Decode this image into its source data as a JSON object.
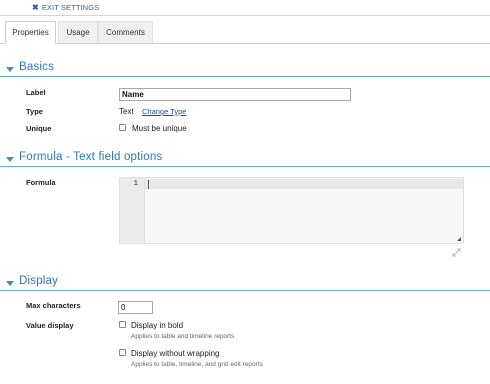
{
  "topbar": {
    "exit_label": "EXIT SETTINGS",
    "exit_icon": "close-icon"
  },
  "tabs": [
    {
      "label": "Properties",
      "active": true
    },
    {
      "label": "Usage",
      "active": false
    },
    {
      "label": "Comments",
      "active": false
    }
  ],
  "sections": {
    "basics": "Basics",
    "formula": "Formula - Text field options",
    "display": "Display"
  },
  "basics": {
    "label_label": "Label",
    "label_value": "Name",
    "type_label": "Type",
    "type_value": "Text",
    "change_type_link": "Change Type",
    "unique_label": "Unique",
    "unique_checkbox_label": "Must be unique",
    "unique_checked": false
  },
  "formula": {
    "label": "Formula",
    "line_number": "1",
    "content": ""
  },
  "display": {
    "max_chars_label": "Max characters",
    "max_chars_value": "0",
    "value_display_label": "Value display",
    "bold_label": "Display in bold",
    "bold_hint": "Applies to table and timeline reports",
    "bold_checked": false,
    "nowrap_label": "Display without wrapping",
    "nowrap_hint": "Applies to table, timeline, and grid edit reports",
    "nowrap_checked": false
  },
  "colors": {
    "accent": "#2c78b8",
    "rule": "#6aa7d6",
    "link": "#1f4fa0"
  }
}
